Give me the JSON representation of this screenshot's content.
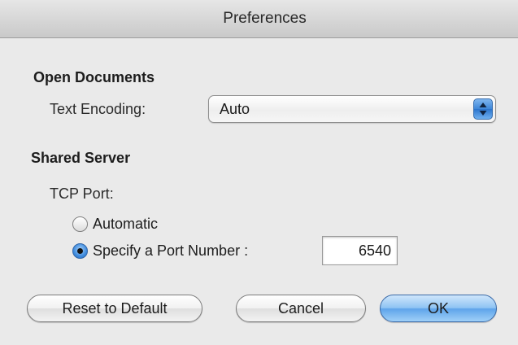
{
  "window": {
    "title": "Preferences"
  },
  "open_documents": {
    "heading": "Open Documents",
    "encoding_label": "Text Encoding:",
    "encoding_value": "Auto"
  },
  "shared_server": {
    "heading": "Shared Server",
    "tcp_port_label": "TCP Port:",
    "radio_automatic": "Automatic",
    "radio_specify": "Specify a Port Number :",
    "selected_option": "Specify a Port Number :",
    "port_value": "6540"
  },
  "buttons": {
    "reset": "Reset to Default",
    "cancel": "Cancel",
    "ok": "OK"
  },
  "colors": {
    "accent": "#5ea4ea"
  }
}
